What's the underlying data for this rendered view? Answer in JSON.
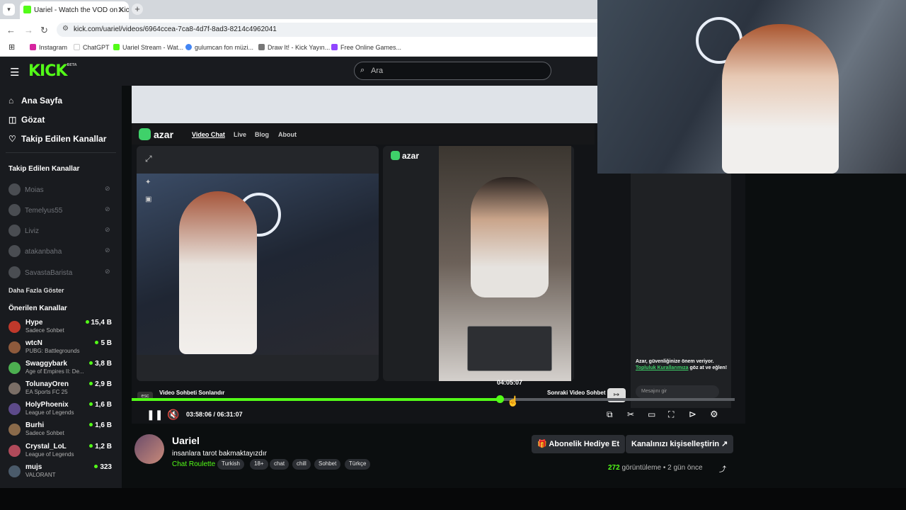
{
  "browser": {
    "tab_title": "Uariel - Watch the VOD on Kick",
    "url": "kick.com/uariel/videos/6964ccea-7ca8-4d7f-8ad3-8214c4962041",
    "bookmarks": [
      "Instagram",
      "ChatGPT",
      "Uariel Stream - Wat...",
      "gulumcan fon müzi...",
      "Draw It! - Kick Yayın...",
      "Free Online Games..."
    ]
  },
  "header": {
    "logo": "KICK",
    "logo_badge": "BETA",
    "search_placeholder": "Ara"
  },
  "sidebar": {
    "nav": [
      {
        "label": "Ana Sayfa",
        "icon": "home-icon"
      },
      {
        "label": "Gözat",
        "icon": "browse-icon"
      },
      {
        "label": "Takip Edilen Kanallar",
        "icon": "heart-icon"
      }
    ],
    "followed_title": "Takip Edilen Kanallar",
    "followed": [
      "Moias",
      "Temelyus55",
      "Liviz",
      "atakanbaha",
      "SavastaBarista"
    ],
    "show_more": "Daha Fazla Göster",
    "recommended_title": "Önerilen Kanallar",
    "recommended": [
      {
        "name": "Hype",
        "category": "Sadece Sohbet",
        "viewers": "15,4 B",
        "color": "#c0392b"
      },
      {
        "name": "wtcN",
        "category": "PUBG: Battlegrounds",
        "viewers": "5 B",
        "color": "#8e5a3c"
      },
      {
        "name": "Swaggybark",
        "category": "Age of Empires II: De...",
        "viewers": "3,8 B",
        "color": "#4caf50"
      },
      {
        "name": "TolunayOren",
        "category": "EA Sports FC 25",
        "viewers": "2,9 B",
        "color": "#7a6e66"
      },
      {
        "name": "HolyPhoenix",
        "category": "League of Legends",
        "viewers": "1,6 B",
        "color": "#5d4a8a"
      },
      {
        "name": "Burhi",
        "category": "Sadece Sohbet",
        "viewers": "1,6 B",
        "color": "#8a6a4a"
      },
      {
        "name": "Crystal_LoL",
        "category": "League of Legends",
        "viewers": "1,2 B",
        "color": "#b04a5a"
      },
      {
        "name": "mujs",
        "category": "VALORANT",
        "viewers": "323",
        "color": "#4a5a6a"
      }
    ]
  },
  "inner_site": {
    "brand": "azar",
    "nav": [
      "Video Chat",
      "Live",
      "Blog",
      "About"
    ],
    "esc_key": "esc",
    "end_chat": "Video Sohbeti Sonlandır",
    "next_chat": "Sonraki Video Sohbet",
    "safety_text": "Azar, güvenliğinize önem veriyor.",
    "safety_link": "Topluluk Kurallarımıza",
    "safety_tail": "göz at ve eğlen!",
    "message_placeholder": "Mesajını gir"
  },
  "player": {
    "hover_time": "04:05:07",
    "current_time": "03:58:06",
    "duration": "06:31:07",
    "progress_percent": 61
  },
  "stream": {
    "channel": "Uariel",
    "title": "insanlara tarot bakmaktayızdır",
    "category": "Chat Roulette",
    "tags": [
      "Turkish",
      "18+",
      "chat",
      "chill",
      "Sohbet",
      "Türkçe"
    ],
    "gift_button": "Abonelik Hediye Et",
    "customize_button": "Kanalınızı kişiselleştirin",
    "views_count": "272",
    "views_label": "görüntüleme",
    "time_ago": "2 gün önce"
  }
}
